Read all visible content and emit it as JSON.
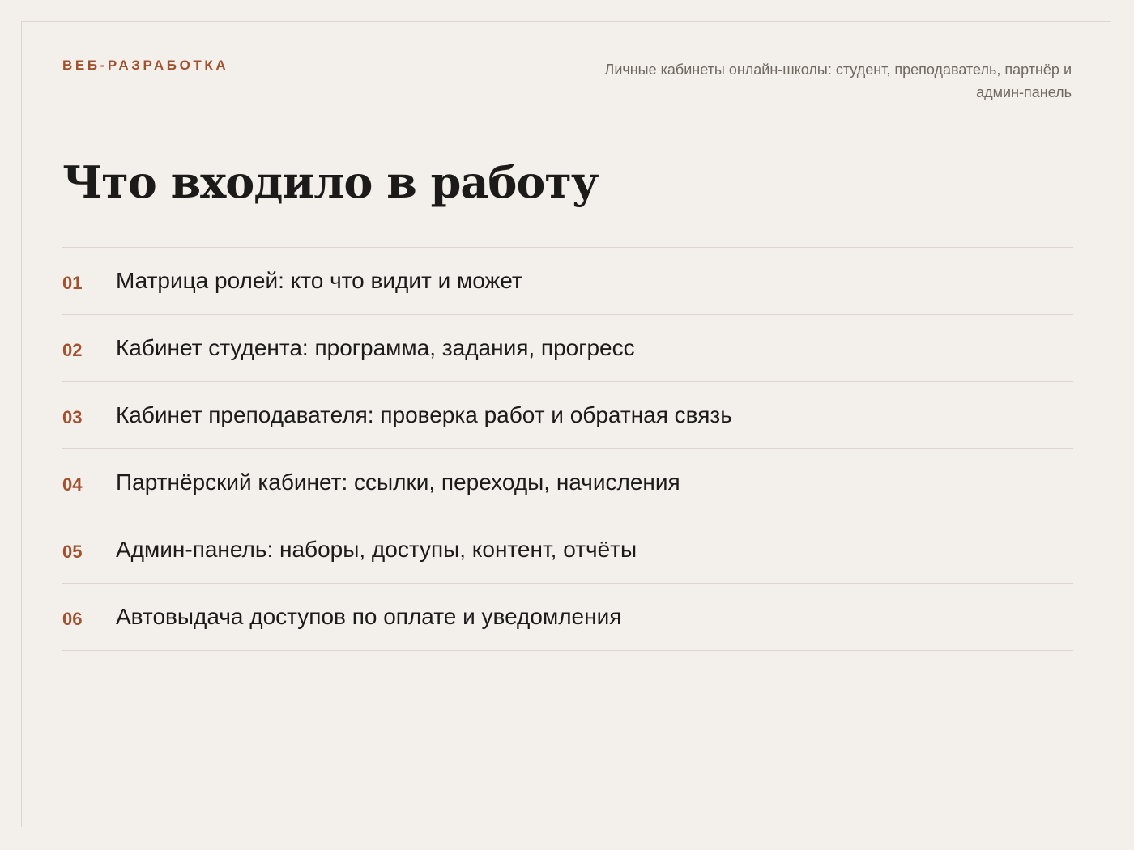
{
  "header": {
    "eyebrow": "ВЕБ-РАЗРАБОТКА",
    "subtitle": "Личные кабинеты онлайн-школы: студент, преподаватель, партнёр и админ-панель"
  },
  "main": {
    "title": "Что входило в работу",
    "items": [
      {
        "number": "01",
        "text": "Матрица ролей: кто что видит и может"
      },
      {
        "number": "02",
        "text": "Кабинет студента: программа, задания, прогресс"
      },
      {
        "number": "03",
        "text": "Кабинет преподавателя: проверка работ и обратная связь"
      },
      {
        "number": "04",
        "text": "Партнёрский кабинет: ссылки, переходы, начисления"
      },
      {
        "number": "05",
        "text": "Админ-панель: наборы, доступы, контент, отчёты"
      },
      {
        "number": "06",
        "text": "Автовыдача доступов по оплате и уведомления"
      }
    ]
  },
  "colors": {
    "accent": "#a2512e",
    "background": "#f3efea",
    "text": "#1c1b1a",
    "muted": "#6f6962",
    "divider": "#dcd6cf"
  }
}
